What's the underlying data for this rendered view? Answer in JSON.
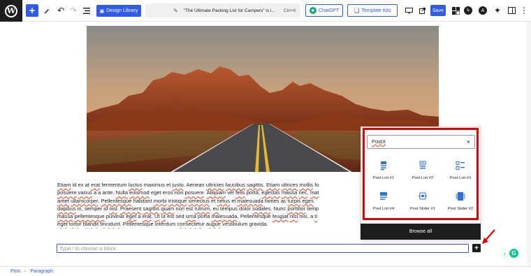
{
  "toolbar": {
    "add_icon": "plus-icon",
    "design_library_label": "Design Library",
    "document_title": "\"The Ultimate Packing List for Campers\" is l...",
    "shortcut": "Ctrl+K",
    "chatgpt_label": "ChatGPT",
    "template_kits_label": "Template Kits",
    "save_label": "Save",
    "accent_color": "#2f5bea"
  },
  "editor": {
    "paragraph_lines": [
      [
        "Etiam",
        " id ex at ",
        "erat",
        " fermentum ",
        "luctus",
        " maximus et ",
        "justo",
        ". Aenean ",
        "ultricies",
        " ",
        "faucibus",
        " ",
        "sagittis",
        ". ",
        "Etiam",
        " ",
        "ultrices",
        " ",
        "mollis",
        " fo"
      ],
      [
        "posuere",
        " ",
        "varius",
        " a a ante. ",
        "Nulla",
        " ",
        "euismod",
        " eget eros non ",
        "posuere",
        ". ",
        "Aliquam",
        " vel ",
        "felis",
        " porta, ",
        "egestas",
        " ",
        "massa",
        " ",
        "nec",
        ", ",
        "mat"
      ],
      [
        "amet",
        " ",
        "ullamcorper",
        ". ",
        "Pellentesque",
        " habitant ",
        "morbi",
        " ",
        "tristique",
        " ",
        "senectus",
        " et ",
        "netus",
        " et ",
        "malesuada",
        " fames ac ",
        "turpis",
        " ",
        "eges"
      ],
      [
        "dapibus",
        " in, semper id ",
        "nisl",
        ". ",
        "Praesent",
        " ",
        "sagittis",
        " ",
        "quam",
        " non est ",
        "rutrum",
        ", ",
        "eu",
        " tempus dolor ",
        "sodales",
        ". Nunc ",
        "porttitor",
        " temp"
      ],
      [
        "massa",
        " ",
        "pellentesque",
        " pulvinar ",
        "eget",
        " a ",
        "erat",
        ". ",
        "Ut",
        " ",
        "ut",
        " est sed ",
        "urna",
        " porta ",
        "malesuada",
        ". Pellentesque ",
        "feugiat",
        " ",
        "nisl",
        " nisi, a ",
        "ti"
      ],
      [
        "eget",
        " ",
        "tortor",
        " ",
        "blandit",
        " ",
        "tincidunt",
        ". Pellentesque interdum ",
        "consectetur",
        " ",
        "augue",
        " vestibulum gravida."
      ]
    ],
    "block_placeholder": "Type / to choose a block"
  },
  "inserter": {
    "search_value": "PostX",
    "highlight_color": "#e00000",
    "blocks": [
      {
        "label": "Post List #1",
        "icon": "post-list-1-icon"
      },
      {
        "label": "Post List #2",
        "icon": "post-list-2-icon"
      },
      {
        "label": "Post List #3",
        "icon": "post-list-3-icon"
      },
      {
        "label": "Post List #4",
        "icon": "post-list-4-icon"
      },
      {
        "label": "Post Slider #1",
        "icon": "post-slider-1-icon"
      },
      {
        "label": "Post Slider #2",
        "icon": "post-slider-2-icon"
      }
    ],
    "browse_all_label": "Browse all"
  },
  "breadcrumb": {
    "items": [
      "Post",
      "Paragraph"
    ]
  }
}
